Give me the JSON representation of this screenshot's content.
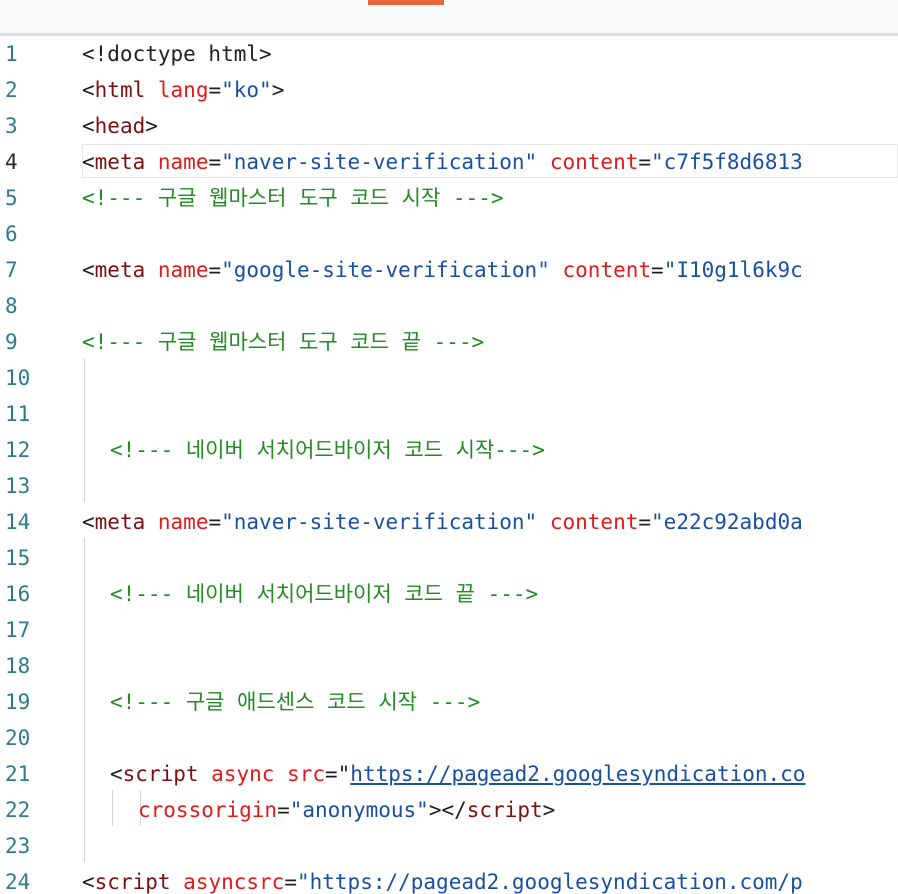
{
  "lines": [
    {
      "num": "1",
      "indent": 0,
      "tokens": [
        {
          "t": "punct",
          "v": "<!doctype html>"
        }
      ]
    },
    {
      "num": "2",
      "indent": 0,
      "tokens": [
        {
          "t": "punct",
          "v": "<"
        },
        {
          "t": "tag",
          "v": "html"
        },
        {
          "t": "punct",
          "v": " "
        },
        {
          "t": "attr",
          "v": "lang"
        },
        {
          "t": "punct",
          "v": "="
        },
        {
          "t": "val",
          "v": "\"ko\""
        },
        {
          "t": "punct",
          "v": ">"
        }
      ]
    },
    {
      "num": "3",
      "indent": 0,
      "tokens": [
        {
          "t": "punct",
          "v": "<"
        },
        {
          "t": "tag",
          "v": "head"
        },
        {
          "t": "punct",
          "v": ">"
        }
      ]
    },
    {
      "num": "4",
      "indent": 0,
      "current": true,
      "tokens": [
        {
          "t": "punct",
          "v": "<"
        },
        {
          "t": "tag",
          "v": "meta"
        },
        {
          "t": "punct",
          "v": " "
        },
        {
          "t": "attr",
          "v": "name"
        },
        {
          "t": "punct",
          "v": "="
        },
        {
          "t": "val",
          "v": "\"naver-site-verification\""
        },
        {
          "t": "punct",
          "v": " "
        },
        {
          "t": "attr",
          "v": "content"
        },
        {
          "t": "punct",
          "v": "="
        },
        {
          "t": "val",
          "v": "\"c7f5f8d6813"
        }
      ]
    },
    {
      "num": "5",
      "indent": 0,
      "tokens": [
        {
          "t": "comment",
          "v": "<!--- 구글 웹마스터 도구 코드 시작 --->"
        }
      ]
    },
    {
      "num": "6",
      "indent": 0,
      "tokens": []
    },
    {
      "num": "7",
      "indent": 0,
      "tokens": [
        {
          "t": "punct",
          "v": "<"
        },
        {
          "t": "tag",
          "v": "meta"
        },
        {
          "t": "punct",
          "v": " "
        },
        {
          "t": "attr",
          "v": "name"
        },
        {
          "t": "punct",
          "v": "="
        },
        {
          "t": "val",
          "v": "\"google-site-verification\""
        },
        {
          "t": "punct",
          "v": " "
        },
        {
          "t": "attr",
          "v": "content"
        },
        {
          "t": "punct",
          "v": "="
        },
        {
          "t": "val",
          "v": "\"I10g1l6k9c"
        }
      ]
    },
    {
      "num": "8",
      "indent": 0,
      "tokens": []
    },
    {
      "num": "9",
      "indent": 0,
      "tokens": [
        {
          "t": "comment",
          "v": "<!--- 구글 웹마스터 도구 코드 끝 --->"
        }
      ]
    },
    {
      "num": "10",
      "indent": 0,
      "tokens": []
    },
    {
      "num": "11",
      "indent": 0,
      "tokens": []
    },
    {
      "num": "12",
      "indent": 1,
      "tokens": [
        {
          "t": "comment",
          "v": "<!--- 네이버 서치어드바이저 코드 시작--->"
        }
      ]
    },
    {
      "num": "13",
      "indent": 0,
      "tokens": []
    },
    {
      "num": "14",
      "indent": 0,
      "tokens": [
        {
          "t": "punct",
          "v": "<"
        },
        {
          "t": "tag",
          "v": "meta"
        },
        {
          "t": "punct",
          "v": " "
        },
        {
          "t": "attr",
          "v": "name"
        },
        {
          "t": "punct",
          "v": "="
        },
        {
          "t": "val",
          "v": "\"naver-site-verification\""
        },
        {
          "t": "punct",
          "v": " "
        },
        {
          "t": "attr",
          "v": "content"
        },
        {
          "t": "punct",
          "v": "="
        },
        {
          "t": "val",
          "v": "\"e22c92abd0a"
        }
      ]
    },
    {
      "num": "15",
      "indent": 0,
      "tokens": []
    },
    {
      "num": "16",
      "indent": 1,
      "tokens": [
        {
          "t": "comment",
          "v": "<!--- 네이버 서치어드바이저 코드 끝 --->"
        }
      ]
    },
    {
      "num": "17",
      "indent": 0,
      "tokens": []
    },
    {
      "num": "18",
      "indent": 0,
      "tokens": []
    },
    {
      "num": "19",
      "indent": 1,
      "tokens": [
        {
          "t": "comment",
          "v": "<!--- 구글 애드센스 코드 시작 --->"
        }
      ]
    },
    {
      "num": "20",
      "indent": 0,
      "tokens": []
    },
    {
      "num": "21",
      "indent": 1,
      "tokens": [
        {
          "t": "punct",
          "v": "<"
        },
        {
          "t": "tag",
          "v": "script"
        },
        {
          "t": "punct",
          "v": " "
        },
        {
          "t": "attr",
          "v": "async"
        },
        {
          "t": "punct",
          "v": " "
        },
        {
          "t": "attr",
          "v": "src"
        },
        {
          "t": "punct",
          "v": "="
        },
        {
          "t": "punct",
          "v": "\""
        },
        {
          "t": "link",
          "v": "https://pagead2.googlesyndication.co"
        }
      ]
    },
    {
      "num": "22",
      "indent": 2,
      "tokens": [
        {
          "t": "attr",
          "v": "crossorigin"
        },
        {
          "t": "punct",
          "v": "="
        },
        {
          "t": "val",
          "v": "\"anonymous\""
        },
        {
          "t": "punct",
          "v": "></"
        },
        {
          "t": "tag",
          "v": "script"
        },
        {
          "t": "punct",
          "v": ">"
        }
      ]
    },
    {
      "num": "23",
      "indent": 0,
      "tokens": []
    },
    {
      "num": "24",
      "indent": 0,
      "tokens": [
        {
          "t": "punct",
          "v": "<"
        },
        {
          "t": "tag",
          "v": "script"
        },
        {
          "t": "punct",
          "v": " "
        },
        {
          "t": "attr",
          "v": "asyncsrc"
        },
        {
          "t": "punct",
          "v": "="
        },
        {
          "t": "val",
          "v": "\"https://pagead2.googlesyndication.com/p"
        }
      ]
    }
  ]
}
